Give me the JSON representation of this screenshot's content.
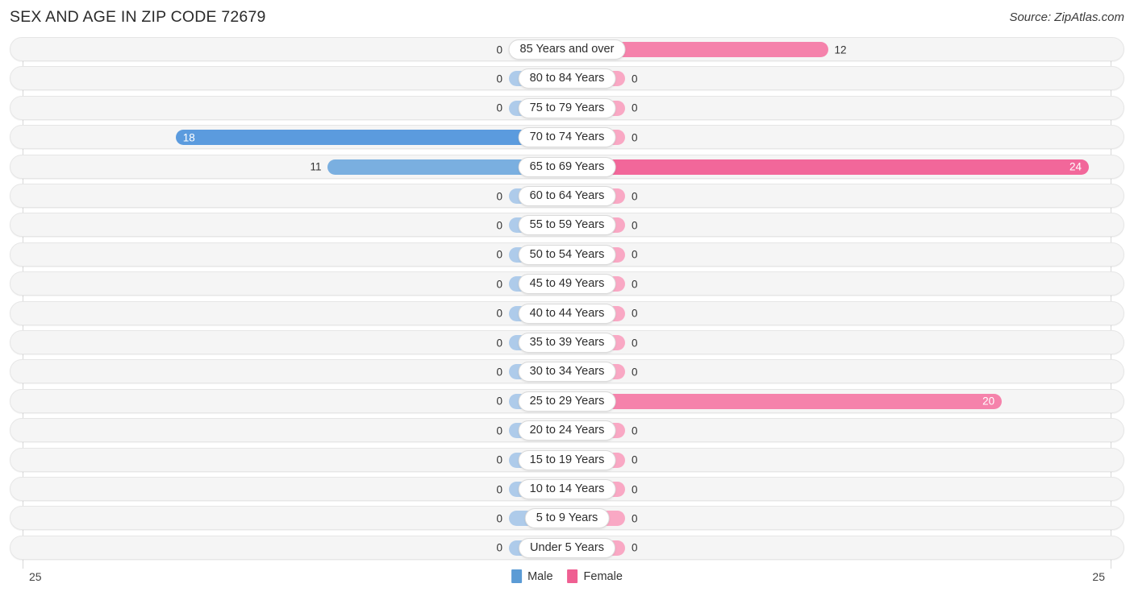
{
  "header": {
    "title": "SEX AND AGE IN ZIP CODE 72679",
    "source": "Source: ZipAtlas.com"
  },
  "legend": {
    "male": {
      "label": "Male",
      "color": "#5b9bd5"
    },
    "female": {
      "label": "Female",
      "color": "#ef5f92"
    }
  },
  "axis": {
    "left_tick": "25",
    "right_tick": "25",
    "max": 25
  },
  "colors": {
    "male_zero": "#aecbea",
    "male_low": "#7aafe0",
    "male_high": "#5b9bde",
    "female_zero": "#f9a8c4",
    "female_low": "#f582ab",
    "female_high": "#f2679a",
    "track_fill": "#f5f5f5",
    "track_border": "#e6e6e6",
    "axis_line": "#d8d8d8"
  },
  "chart_data": {
    "type": "bar",
    "title": "SEX AND AGE IN ZIP CODE 72679",
    "subtitle": "Source: ZipAtlas.com",
    "orientation": "horizontal",
    "style": "diverging-population-pyramid",
    "xlabel": "",
    "ylabel": "",
    "xlim": [
      -25,
      25
    ],
    "axis_ticks": [
      "25",
      "25"
    ],
    "grid": false,
    "legend_position": "bottom-center",
    "categories": [
      "85 Years and over",
      "80 to 84 Years",
      "75 to 79 Years",
      "70 to 74 Years",
      "65 to 69 Years",
      "60 to 64 Years",
      "55 to 59 Years",
      "50 to 54 Years",
      "45 to 49 Years",
      "40 to 44 Years",
      "35 to 39 Years",
      "30 to 34 Years",
      "25 to 29 Years",
      "20 to 24 Years",
      "15 to 19 Years",
      "10 to 14 Years",
      "5 to 9 Years",
      "Under 5 Years"
    ],
    "series": [
      {
        "name": "Male",
        "values": [
          0,
          0,
          0,
          18,
          11,
          0,
          0,
          0,
          0,
          0,
          0,
          0,
          0,
          0,
          0,
          0,
          0,
          0
        ]
      },
      {
        "name": "Female",
        "values": [
          12,
          0,
          0,
          0,
          24,
          0,
          0,
          0,
          0,
          0,
          0,
          0,
          20,
          0,
          0,
          0,
          0,
          0
        ]
      }
    ]
  },
  "rows": [
    {
      "label": "85 Years and over",
      "male": 0,
      "male_text": "0",
      "female": 12,
      "female_text": "12"
    },
    {
      "label": "80 to 84 Years",
      "male": 0,
      "male_text": "0",
      "female": 0,
      "female_text": "0"
    },
    {
      "label": "75 to 79 Years",
      "male": 0,
      "male_text": "0",
      "female": 0,
      "female_text": "0"
    },
    {
      "label": "70 to 74 Years",
      "male": 18,
      "male_text": "18",
      "female": 0,
      "female_text": "0"
    },
    {
      "label": "65 to 69 Years",
      "male": 11,
      "male_text": "11",
      "female": 24,
      "female_text": "24"
    },
    {
      "label": "60 to 64 Years",
      "male": 0,
      "male_text": "0",
      "female": 0,
      "female_text": "0"
    },
    {
      "label": "55 to 59 Years",
      "male": 0,
      "male_text": "0",
      "female": 0,
      "female_text": "0"
    },
    {
      "label": "50 to 54 Years",
      "male": 0,
      "male_text": "0",
      "female": 0,
      "female_text": "0"
    },
    {
      "label": "45 to 49 Years",
      "male": 0,
      "male_text": "0",
      "female": 0,
      "female_text": "0"
    },
    {
      "label": "40 to 44 Years",
      "male": 0,
      "male_text": "0",
      "female": 0,
      "female_text": "0"
    },
    {
      "label": "35 to 39 Years",
      "male": 0,
      "male_text": "0",
      "female": 0,
      "female_text": "0"
    },
    {
      "label": "30 to 34 Years",
      "male": 0,
      "male_text": "0",
      "female": 0,
      "female_text": "0"
    },
    {
      "label": "25 to 29 Years",
      "male": 0,
      "male_text": "0",
      "female": 20,
      "female_text": "20"
    },
    {
      "label": "20 to 24 Years",
      "male": 0,
      "male_text": "0",
      "female": 0,
      "female_text": "0"
    },
    {
      "label": "15 to 19 Years",
      "male": 0,
      "male_text": "0",
      "female": 0,
      "female_text": "0"
    },
    {
      "label": "10 to 14 Years",
      "male": 0,
      "male_text": "0",
      "female": 0,
      "female_text": "0"
    },
    {
      "label": "5 to 9 Years",
      "male": 0,
      "male_text": "0",
      "female": 0,
      "female_text": "0"
    },
    {
      "label": "Under 5 Years",
      "male": 0,
      "male_text": "0",
      "female": 0,
      "female_text": "0"
    }
  ]
}
